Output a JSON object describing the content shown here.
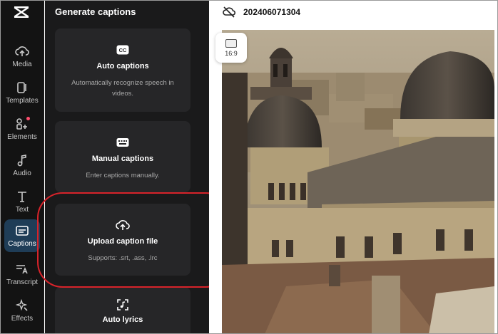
{
  "rail": {
    "items": [
      {
        "label": "Media",
        "icon": "cloud-upload-icon"
      },
      {
        "label": "Templates",
        "icon": "templates-icon"
      },
      {
        "label": "Elements",
        "icon": "elements-icon"
      },
      {
        "label": "Audio",
        "icon": "music-note-icon"
      },
      {
        "label": "Text",
        "icon": "text-icon"
      },
      {
        "label": "Captions",
        "icon": "captions-icon"
      },
      {
        "label": "Transcript",
        "icon": "transcript-icon"
      },
      {
        "label": "Effects",
        "icon": "effects-icon"
      }
    ],
    "active": "Captions"
  },
  "panel": {
    "title": "Generate captions",
    "cards": [
      {
        "title": "Auto captions",
        "desc": "Automatically recognize speech in videos."
      },
      {
        "title": "Manual captions",
        "desc": "Enter captions manually."
      },
      {
        "title": "Upload caption file",
        "desc": "Supports: .srt, .ass, .lrc"
      },
      {
        "title": "Auto lyrics",
        "desc": ""
      }
    ]
  },
  "preview": {
    "project_name": "202406071304",
    "aspect_ratio": "16:9"
  },
  "colors": {
    "active_rail": "#1f3d57",
    "highlight": "#d8232a"
  }
}
